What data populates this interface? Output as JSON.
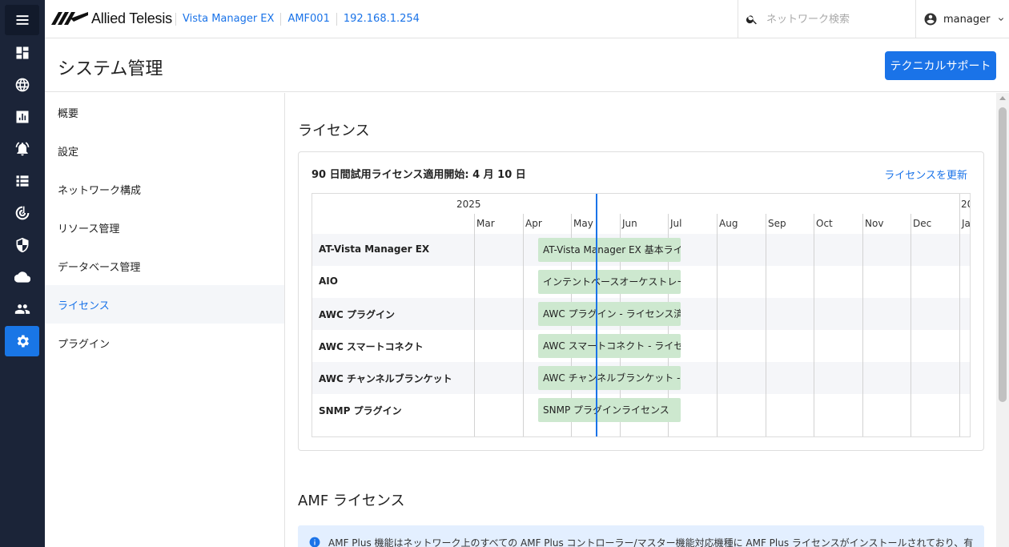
{
  "rail": {
    "items": [
      {
        "name": "menu-icon"
      },
      {
        "name": "dashboard-icon"
      },
      {
        "name": "globe-icon"
      },
      {
        "name": "bar-chart-icon"
      },
      {
        "name": "alarm-icon"
      },
      {
        "name": "list-icon"
      },
      {
        "name": "radar-icon"
      },
      {
        "name": "shield-icon"
      },
      {
        "name": "cloud-icon"
      },
      {
        "name": "users-icon"
      },
      {
        "name": "gear-icon",
        "active": true
      }
    ],
    "active_color": "#1976e6",
    "background": "#1b2438"
  },
  "header": {
    "logo_text": "Allied Telesis",
    "breadcrumbs": [
      "Vista Manager EX",
      "AMF001",
      "192.168.1.254"
    ],
    "search_placeholder": "ネットワーク検索",
    "user_name": "manager"
  },
  "page": {
    "title": "システム管理",
    "support_button": "テクニカルサポート"
  },
  "sidenav": {
    "items": [
      "概要",
      "設定",
      "ネットワーク構成",
      "リソース管理",
      "データベース管理",
      "ライセンス",
      "プラグイン"
    ],
    "active_index": 5
  },
  "license": {
    "section_title": "ライセンス",
    "trial_text": "90 日間試用ライセンス適用開始: 4 月 10 日",
    "update_link": "ライセンスを更新",
    "timeline": {
      "year_labels": [
        "2025",
        "20"
      ],
      "months": [
        "Mar",
        "Apr",
        "May",
        "Jun",
        "Jul",
        "Aug",
        "Sep",
        "Oct",
        "Nov",
        "Dec",
        "Ja"
      ],
      "rows": [
        {
          "label": "AT-Vista Manager EX",
          "bar": "AT-Vista Manager EX 基本ライセ"
        },
        {
          "label": "AIO",
          "bar": "インテントベースオーケストレー"
        },
        {
          "label": "AWC プラグイン",
          "bar": "AWC プラグイン - ライセンス済"
        },
        {
          "label": "AWC スマートコネクト",
          "bar": "AWC スマートコネクト - ライセ"
        },
        {
          "label": "AWC チャンネルブランケット",
          "bar": "AWC チャンネルブランケット -"
        },
        {
          "label": "SNMP プラグイン",
          "bar": " SNMP プラグインライセンス"
        }
      ],
      "bar_color": "#cde8cf",
      "today_color": "#1a73e8"
    }
  },
  "amf": {
    "section_title": "AMF ライセンス",
    "info_text": "AMF Plus 機能はネットワーク上のすべての AMF Plus コントローラー/マスター機能対応機種に AMF Plus ライセンスがインストールされており、有"
  }
}
